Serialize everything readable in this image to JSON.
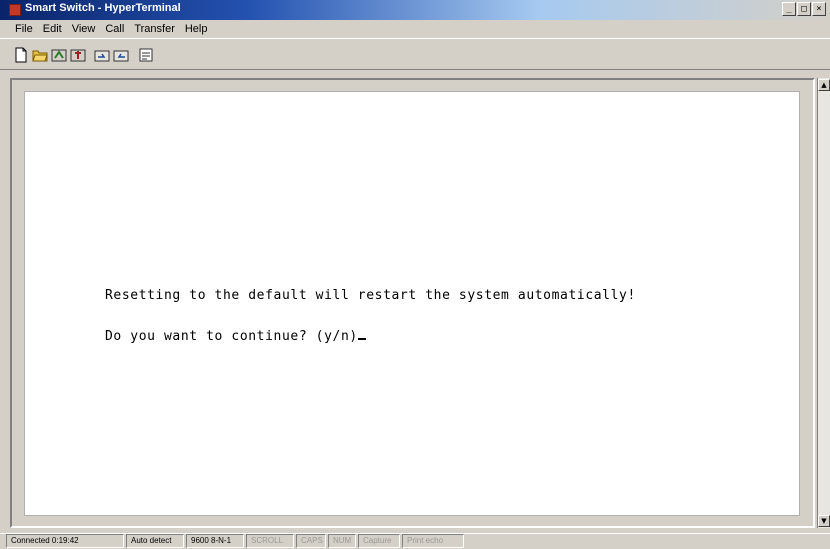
{
  "window": {
    "title": "Smart Switch - HyperTerminal",
    "controls": {
      "minimize": "_",
      "maximize": "□",
      "close": "×"
    }
  },
  "menu": [
    "File",
    "Edit",
    "View",
    "Call",
    "Transfer",
    "Help"
  ],
  "toolbar": {
    "buttons": [
      "new-icon",
      "open-icon",
      "connect-icon",
      "disconnect-icon",
      "send-icon",
      "receive-icon",
      "properties-icon"
    ]
  },
  "terminal": {
    "line1": "Resetting to the default will restart the system automatically!",
    "line2": "Do you want to continue? (y/n)"
  },
  "status": {
    "connected": "Connected 0:19:42",
    "detect": "Auto detect",
    "settings": "9600 8-N-1",
    "scroll": "SCROLL",
    "caps": "CAPS",
    "num": "NUM",
    "capture": "Capture",
    "print_echo": "Print echo"
  }
}
